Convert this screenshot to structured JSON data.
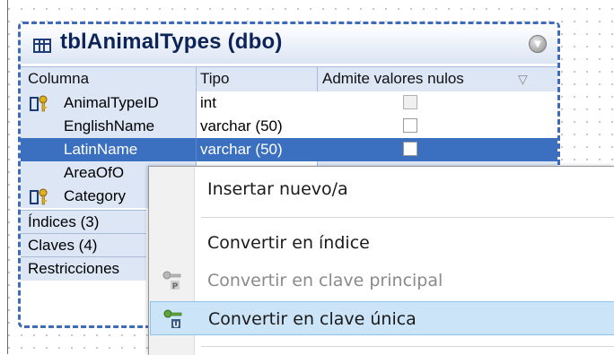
{
  "table": {
    "title": "tblAnimalTypes (dbo)",
    "columns_header": {
      "col_name": "Columna",
      "col_type": "Tipo",
      "col_nullable": "Admite valores nulos"
    },
    "rows": [
      {
        "name": "AnimalTypeID",
        "type": "int",
        "key": "primary-foreign",
        "nullable": false,
        "disabled": true
      },
      {
        "name": "EnglishName",
        "type": "varchar (50)",
        "key": "",
        "nullable": false
      },
      {
        "name": "LatinName",
        "type": "varchar (50)",
        "key": "",
        "nullable": false,
        "selected": true
      },
      {
        "name": "AreaOfO",
        "type": "",
        "key": ""
      },
      {
        "name": "Category",
        "type": "",
        "key": "primary-foreign"
      }
    ],
    "sections": {
      "indexes": "Índices (3)",
      "keys": "Claves (4)",
      "constraints": "Restricciones"
    }
  },
  "context_menu": {
    "items": [
      {
        "label": "Insertar nuevo/a",
        "icon": "",
        "state": "normal"
      },
      {
        "label": "Convertir en índice",
        "icon": "",
        "state": "normal"
      },
      {
        "label": "Convertir en clave principal",
        "icon": "primary-key-icon",
        "state": "disabled"
      },
      {
        "label": "Convertir en clave única",
        "icon": "unique-key-icon",
        "state": "hover"
      }
    ]
  },
  "colors": {
    "selection": "#3b6fc0",
    "header_bg": "#dce6f5",
    "title_text": "#0d2458",
    "menu_hover": "#cce4f7",
    "dashed_border": "#3d6ab9"
  }
}
